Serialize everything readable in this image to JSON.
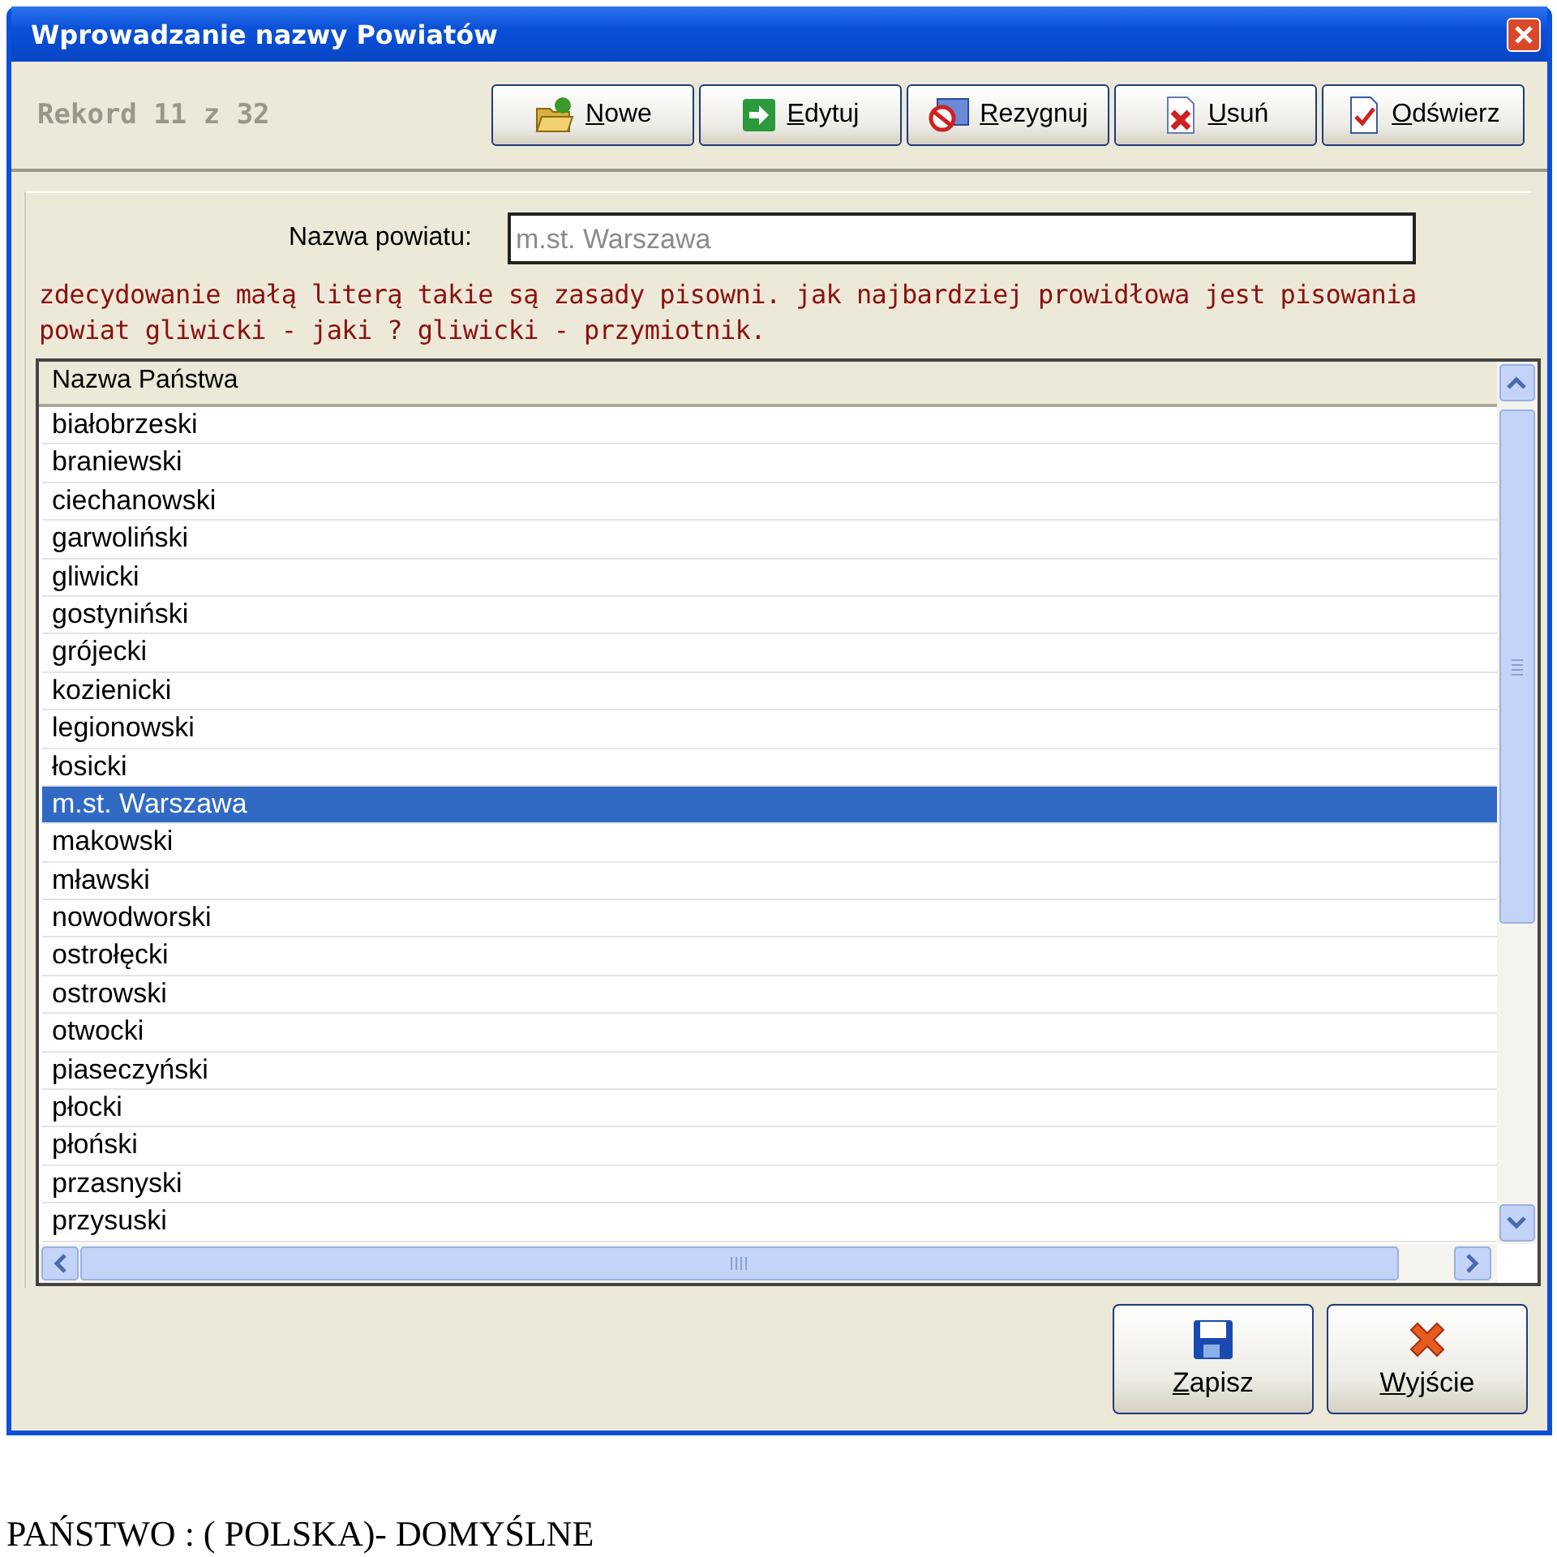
{
  "window": {
    "title": "Wprowadzanie nazwy Powiatów"
  },
  "record_counter": "Rekord 11 z 32",
  "toolbar": [
    {
      "label": "Nowe",
      "kind": "new"
    },
    {
      "label": "Edytuj",
      "kind": "edit"
    },
    {
      "label": "Rezygnuj",
      "kind": "cancel"
    },
    {
      "label": "Usuń",
      "kind": "delete"
    },
    {
      "label": "Odświerz",
      "kind": "refresh"
    }
  ],
  "form": {
    "label": "Nazwa powiatu:",
    "value": "m.st. Warszawa",
    "disabled": true
  },
  "note": "zdecydowanie małą literą takie są zasady pisowni. jak najbardziej prowidłowa jest pisowania powiat gliwicki - jaki ? gliwicki - przymiotnik.",
  "table": {
    "columns": [
      "Nazwa Państwa"
    ],
    "rows": [
      {
        "name": "białobrzeski",
        "selected": false
      },
      {
        "name": "braniewski",
        "selected": false
      },
      {
        "name": "ciechanowski",
        "selected": false
      },
      {
        "name": "garwoliński",
        "selected": false
      },
      {
        "name": "gliwicki",
        "selected": false
      },
      {
        "name": "gostyniński",
        "selected": false
      },
      {
        "name": "grójecki",
        "selected": false
      },
      {
        "name": "kozienicki",
        "selected": false
      },
      {
        "name": "legionowski",
        "selected": false
      },
      {
        "name": "łosicki",
        "selected": false
      },
      {
        "name": "m.st. Warszawa",
        "selected": true
      },
      {
        "name": "makowski",
        "selected": false
      },
      {
        "name": "mławski",
        "selected": false
      },
      {
        "name": "nowodworski",
        "selected": false
      },
      {
        "name": "ostrołęcki",
        "selected": false
      },
      {
        "name": "ostrowski",
        "selected": false
      },
      {
        "name": "otwocki",
        "selected": false
      },
      {
        "name": "piaseczyński",
        "selected": false
      },
      {
        "name": "płocki",
        "selected": false
      },
      {
        "name": "płoński",
        "selected": false
      },
      {
        "name": "przasnyski",
        "selected": false
      },
      {
        "name": "przysuski",
        "selected": false
      }
    ]
  },
  "footer_buttons": [
    {
      "label": "Zapisz",
      "kind": "save"
    },
    {
      "label": "Wyjście",
      "kind": "exit"
    }
  ],
  "caption": "PAŃSTWO : ( POLSKA)- DOMYŚLNE"
}
